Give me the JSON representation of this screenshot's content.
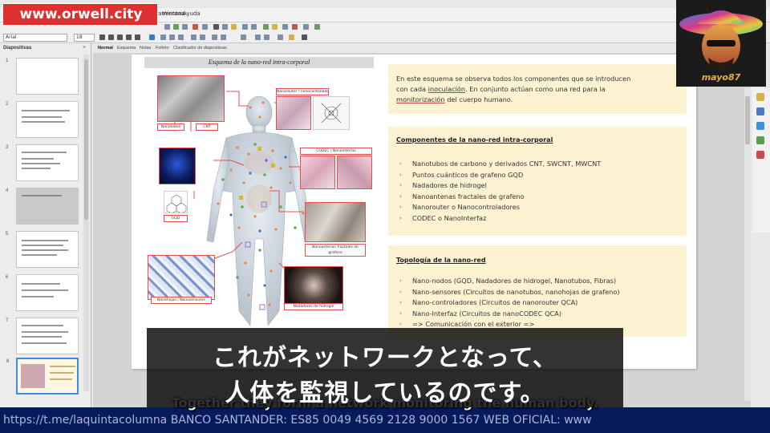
{
  "overlays": {
    "watermark": "www.orwell.city",
    "jp_subtitle_line1": "これがネットワークとなって、",
    "jp_subtitle_line2": "人体を監視しているのです。",
    "en_subtitle": "Together they form a network monitoring the human body.",
    "ticker": "https://t.me/laquintacolumna BANCO SANTANDER: ES85 0049 4569 2128 9000 1567 WEB OFICIAL: www",
    "avatar_text": "mayo87"
  },
  "menubar": {
    "items": [
      "Ir",
      "Herramientas",
      "Ventana",
      "Ayuda"
    ]
  },
  "toolbar": {
    "font_combo": "Arial",
    "size_combo": "18"
  },
  "slides_panel": {
    "title": "Diapositivas",
    "close": "×",
    "numbers": [
      "1",
      "2",
      "3",
      "4",
      "5",
      "6",
      "7",
      "8"
    ]
  },
  "view_tabs": [
    "Normal",
    "Esquema",
    "Notas",
    "Folleto",
    "Clasificador de diapositivas"
  ],
  "slide": {
    "title": "Esquema de la nano-red intra-corporal",
    "intro": {
      "line1": "En este esquema se observa todos los componentes que se introducen",
      "line2a": "con cada ",
      "line2u": "inoculación",
      "line2b": ". En conjunto actúan como una red para la",
      "line3u": "monitorización",
      "line3b": " del cuerpo humano."
    },
    "components": {
      "heading": "Componentes de la nano-red intra-corporal",
      "items": [
        "Nanotubos de carbono y derivados CNT, SWCNT, MWCNT",
        "Puntos cuánticos de grafeno GQD",
        "Nadadores de hidrogel",
        "Nanoantenas fractales de grafeno",
        "Nanorouter o Nanocontroladores",
        "CODEC o NanoInterfaz"
      ]
    },
    "topology": {
      "heading": "Topología de la nano-red",
      "items": [
        "Nano-nodos (GQD, Nadadores de hidrogel, Nanotubos, Fibras)",
        "Nano-sensores (Circuitos de nanotubos, nanohojas de grafeno)",
        "Nano-controladores (Circuitos de nanorouter QCA)",
        "Nano-Interfaz (Circuitos de nanoCODEC QCA)",
        "=> Comunicación con el exterior =>"
      ]
    },
    "captions": {
      "nanotubos": "Nanotubos",
      "cnt": "CNT",
      "router": "Nanorouter / nanocontrolador",
      "codec": "CODEC / Nanointerfaz",
      "gqd": "GQD",
      "antenas": "Nanoantenas fractales de grafeno",
      "nanohojas": "Nanohojas / Nanosensores",
      "nadadores": "Nadadores de hidrogel"
    }
  },
  "colors": {
    "watermark_bg": "#df2f2f",
    "card_bg": "#fdf3d2",
    "connector": "#e05050",
    "ticker_bg": "#071a5c"
  }
}
